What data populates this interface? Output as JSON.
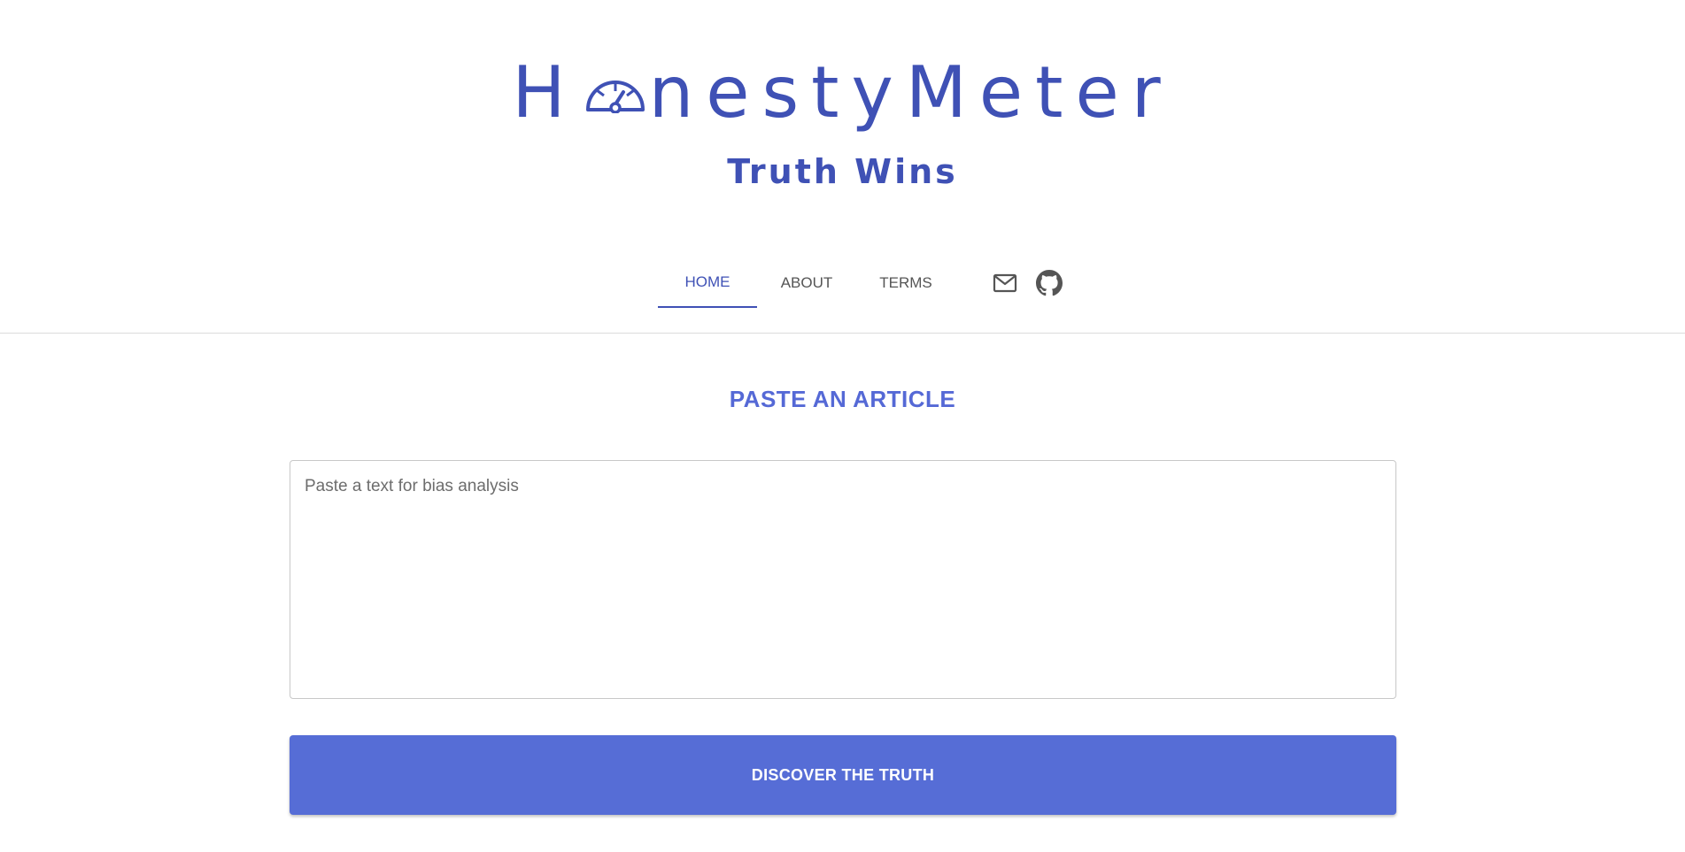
{
  "brand": {
    "logo_prefix": "H",
    "logo_suffix": "nestyMeter",
    "logo_gauge_icon": "gauge-icon",
    "tagline": "Truth Wins",
    "color": "#3f51b5"
  },
  "nav": {
    "tabs": [
      {
        "label": "HOME",
        "active": true
      },
      {
        "label": "ABOUT",
        "active": false
      },
      {
        "label": "TERMS",
        "active": false
      }
    ],
    "icons": [
      "mail-icon",
      "github-icon"
    ]
  },
  "main": {
    "title": "PASTE AN ARTICLE",
    "textarea": {
      "value": "",
      "placeholder": "Paste a text for bias analysis"
    },
    "submit_label": "DISCOVER THE TRUTH",
    "accent": "#566dd6"
  }
}
